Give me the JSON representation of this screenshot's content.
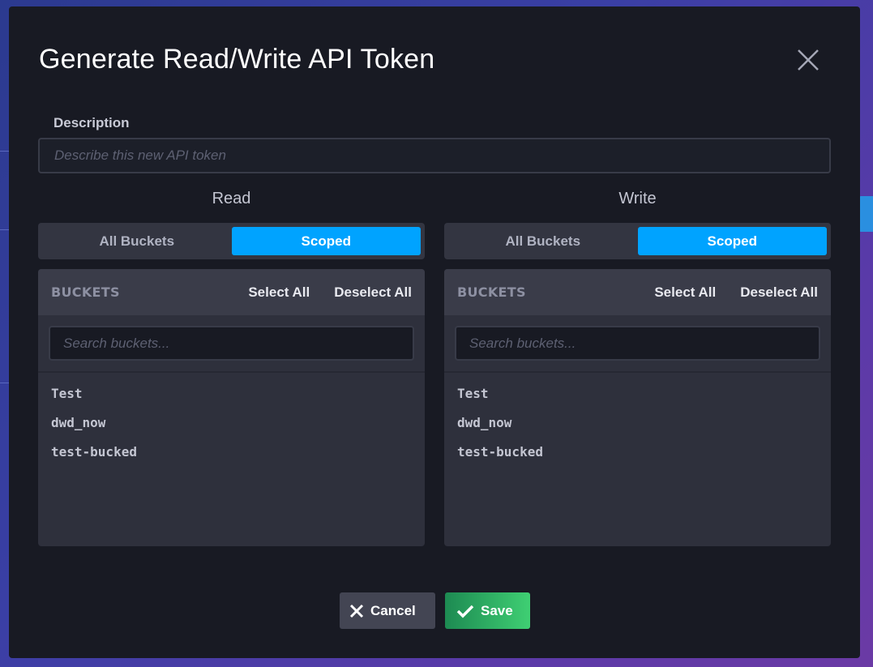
{
  "modal": {
    "title": "Generate Read/Write API Token",
    "close_icon": "close-icon"
  },
  "description": {
    "label": "Description",
    "placeholder": "Describe this new API token",
    "value": ""
  },
  "read": {
    "title": "Read",
    "toggle": {
      "all_label": "All Buckets",
      "scoped_label": "Scoped",
      "selected": "Scoped"
    },
    "buckets": {
      "heading": "BUCKETS",
      "select_all": "Select All",
      "deselect_all": "Deselect All",
      "search_placeholder": "Search buckets...",
      "items": [
        "Test",
        "dwd_now",
        "test-bucked"
      ]
    }
  },
  "write": {
    "title": "Write",
    "toggle": {
      "all_label": "All Buckets",
      "scoped_label": "Scoped",
      "selected": "Scoped"
    },
    "buckets": {
      "heading": "BUCKETS",
      "select_all": "Select All",
      "deselect_all": "Deselect All",
      "search_placeholder": "Search buckets...",
      "items": [
        "Test",
        "dwd_now",
        "test-bucked"
      ]
    }
  },
  "footer": {
    "cancel_label": "Cancel",
    "save_label": "Save"
  },
  "colors": {
    "accent": "#00a3ff",
    "save_start": "#1d8a52",
    "save_end": "#3fcf73",
    "modal_bg": "#181a23"
  }
}
